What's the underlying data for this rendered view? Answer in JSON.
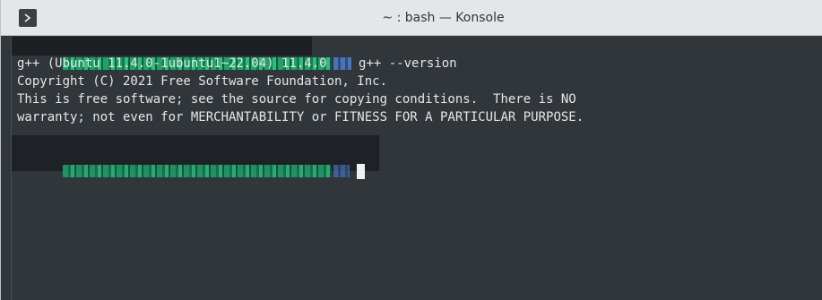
{
  "window": {
    "title": "~ : bash — Konsole",
    "app_icon": "terminal-icon"
  },
  "terminal": {
    "command": "g++ --version",
    "output": [
      "g++ (Ubuntu 11.4.0-1ubuntu1~22.04) 11.4.0",
      "Copyright (C) 2021 Free Software Foundation, Inc.",
      "This is free software; see the source for copying conditions.  There is NO",
      "warranty; not even for MERCHANTABILITY or FITNESS FOR A PARTICULAR PURPOSE."
    ]
  },
  "colors": {
    "titlebar": "#e4e6e8",
    "terminal_bg": "#31363b",
    "text": "#e6e6e6",
    "prompt_green": "#1fa36a",
    "prompt_blue": "#4b73b8"
  }
}
